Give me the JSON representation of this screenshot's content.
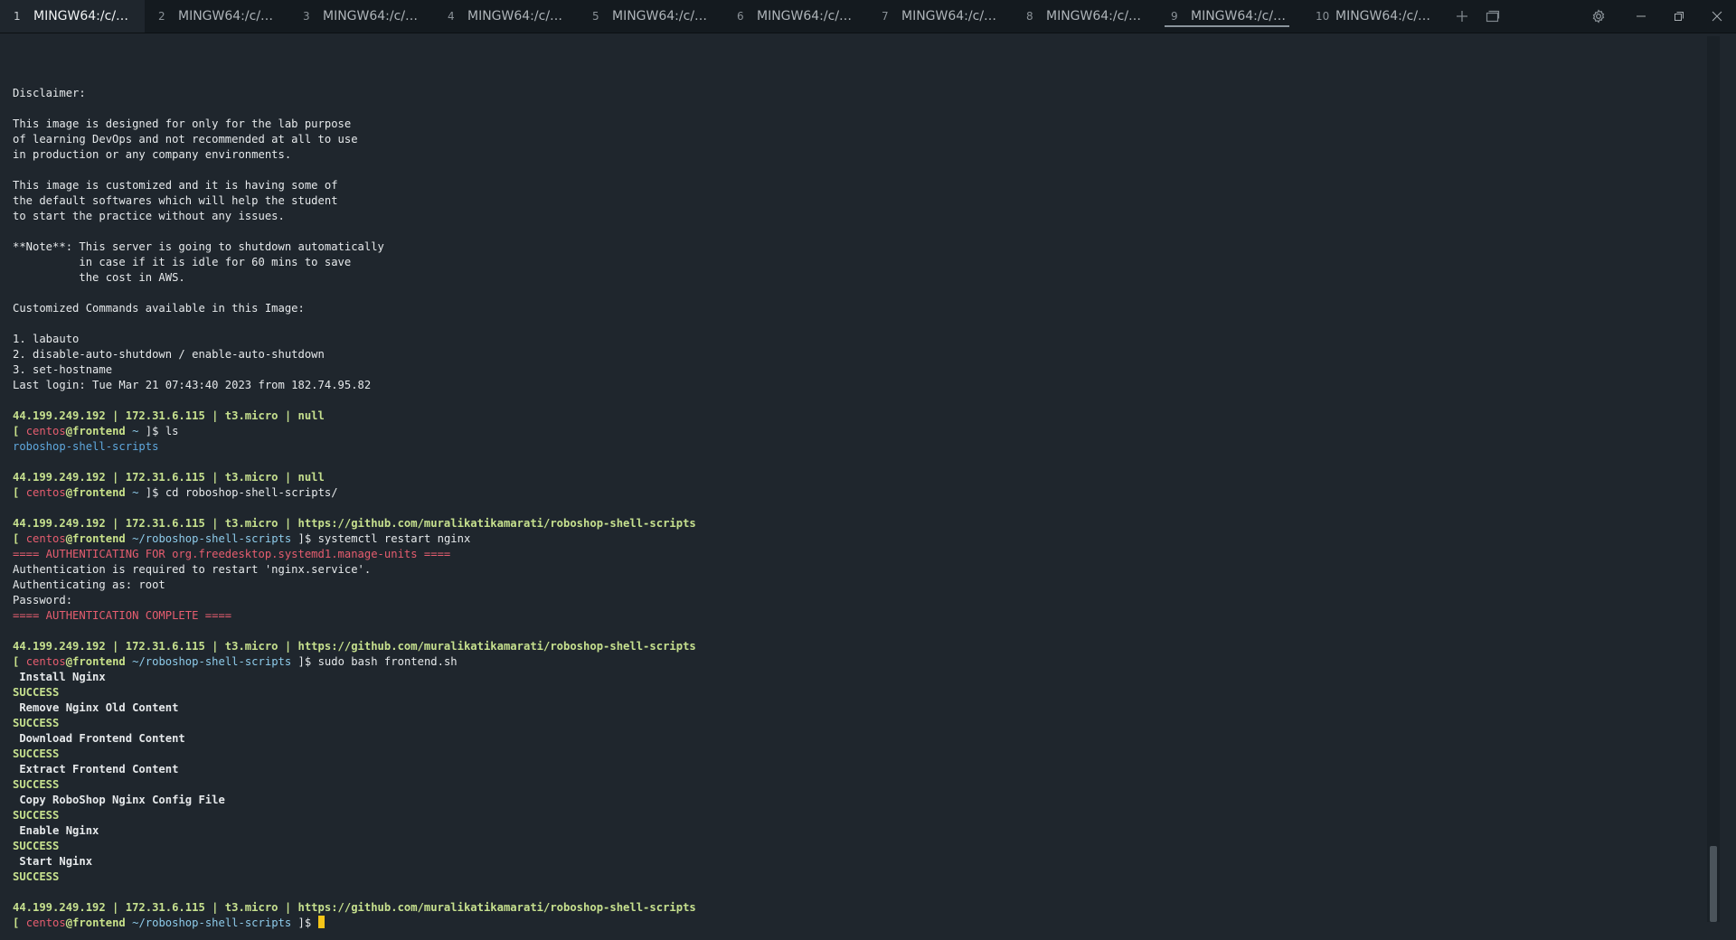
{
  "tabs": [
    {
      "num": "1",
      "label": "MINGW64:/c/Us..."
    },
    {
      "num": "2",
      "label": "MINGW64:/c/Us..."
    },
    {
      "num": "3",
      "label": "MINGW64:/c/Us..."
    },
    {
      "num": "4",
      "label": "MINGW64:/c/Us..."
    },
    {
      "num": "5",
      "label": "MINGW64:/c/Us..."
    },
    {
      "num": "6",
      "label": "MINGW64:/c/Us..."
    },
    {
      "num": "7",
      "label": "MINGW64:/c/Us..."
    },
    {
      "num": "8",
      "label": "MINGW64:/c/Us..."
    },
    {
      "num": "9",
      "label": "MINGW64:/c/Us..."
    },
    {
      "num": "10",
      "label": "MINGW64:/c/Us..."
    }
  ],
  "terminal": {
    "banner": [
      "",
      "Disclaimer:",
      "",
      "This image is designed for only for the lab purpose",
      "of learning DevOps and not recommended at all to use",
      "in production or any company environments.",
      "",
      "This image is customized and it is having some of",
      "the default softwares which will help the student",
      "to start the practice without any issues.",
      "",
      "**Note**: This server is going to shutdown automatically",
      "          in case if it is idle for 60 mins to save",
      "          the cost in AWS.",
      "",
      "Customized Commands available in this Image:",
      "",
      "1. labauto",
      "2. disable-auto-shutdown / enable-auto-shutdown",
      "3. set-hostname",
      "Last login: Tue Mar 21 07:43:40 2023 from 182.74.95.82"
    ],
    "info_null": "44.199.249.192 | 172.31.6.115 | t3.micro | null",
    "info_repo": "44.199.249.192 | 172.31.6.115 | t3.micro | https://github.com/muralikatikamarati/roboshop-shell-scripts",
    "prompt_open": "[ ",
    "user": "centos",
    "at_host": "@frontend",
    "dir_home": " ~",
    "dir_repo": " ~/roboshop-shell-scripts",
    "prompt_close": " ]$ ",
    "cmd_ls": "ls",
    "ls_output": "roboshop-shell-scripts",
    "cmd_cd": "cd roboshop-shell-scripts/",
    "cmd_systemctl": "systemctl restart nginx",
    "auth_start": "==== AUTHENTICATING FOR org.freedesktop.systemd1.manage-units ====",
    "auth_required": "Authentication is required to restart 'nginx.service'.",
    "auth_as": "Authenticating as: root",
    "password": "Password:",
    "auth_complete": "==== AUTHENTICATION COMPLETE ====",
    "cmd_bash": "sudo bash frontend.sh",
    "steps": [
      " Install Nginx",
      " Remove Nginx Old Content",
      " Download Frontend Content",
      " Extract Frontend Content",
      " Copy RoboShop Nginx Config File",
      " Enable Nginx",
      " Start Nginx"
    ],
    "success": "SUCCESS"
  },
  "colors": {
    "background": "#1f262d",
    "tabbar": "#141a1f",
    "green": "#c6e08e",
    "red": "#e65d6f",
    "blue": "#5fa8de",
    "cursor": "#f5c518"
  },
  "icons": [
    "plus-icon",
    "new-window-icon",
    "gear-icon",
    "minimize-icon",
    "restore-icon",
    "close-icon"
  ]
}
